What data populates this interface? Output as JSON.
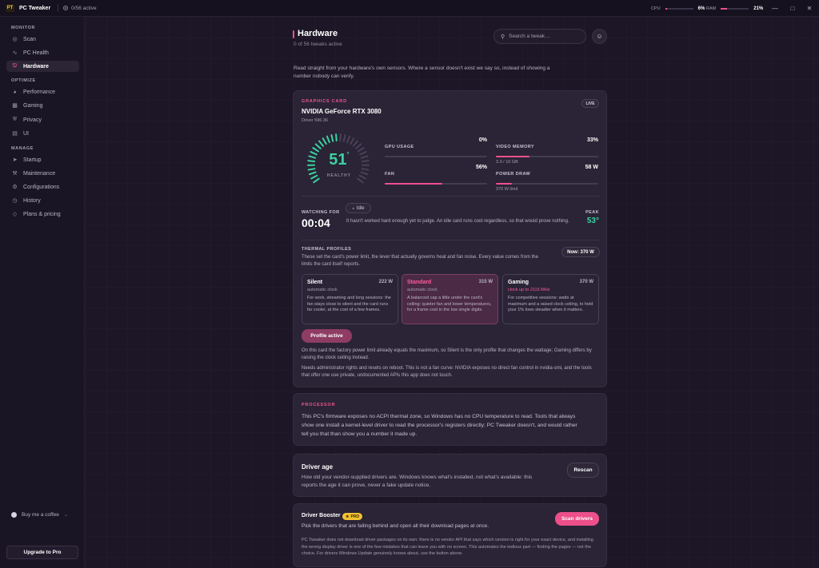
{
  "app": {
    "name": "PC Tweaker",
    "logo_text": "PT",
    "active_status": "0/56 active"
  },
  "meters": {
    "cpu_label": "CPU",
    "cpu_value": "6%",
    "cpu_fraction": 0.06,
    "ram_label": "RAM",
    "ram_value": "21%",
    "ram_fraction": 0.21
  },
  "sidebar": {
    "sections": {
      "monitor": "MONITOR",
      "optimize": "OPTIMIZE",
      "manage": "MANAGE"
    },
    "items": [
      {
        "label": "Scan",
        "icon": "scan-icon"
      },
      {
        "label": "PC Health",
        "icon": "pulse-icon"
      },
      {
        "label": "Hardware",
        "icon": "thermometer-icon",
        "active": true
      },
      {
        "label": "Performance",
        "icon": "gauge-icon"
      },
      {
        "label": "Gaming",
        "icon": "gamepad-icon"
      },
      {
        "label": "Privacy",
        "icon": "shield-icon"
      },
      {
        "label": "UI",
        "icon": "window-icon"
      },
      {
        "label": "Startup",
        "icon": "rocket-icon"
      },
      {
        "label": "Maintenance",
        "icon": "wrench-icon"
      },
      {
        "label": "Configurations",
        "icon": "sliders-icon"
      },
      {
        "label": "History",
        "icon": "clock-icon"
      },
      {
        "label": "Plans & pricing",
        "icon": "diamond-icon"
      }
    ],
    "coffee": "Buy me a coffee",
    "upgrade": "Upgrade to Pro"
  },
  "header": {
    "title": "Hardware",
    "subtitle": "0 of 56 tweaks active",
    "search_placeholder": "Search a tweak…"
  },
  "intro": "Read straight from your hardware's own sensors. Where a sensor doesn't exist we say so, instead of showing a number nobody can verify.",
  "gpu": {
    "tag": "GRAPHICS CARD",
    "name": "NVIDIA GeForce RTX 3080",
    "driver": "Driver 596.36",
    "live": "LIVE",
    "temp": "51",
    "temp_unit": "°",
    "temp_status": "HEALTHY",
    "gauge_fraction": 0.51,
    "stats": [
      {
        "label": "GPU USAGE",
        "value": "0%",
        "fraction": 0.0,
        "note": ""
      },
      {
        "label": "VIDEO MEMORY",
        "value": "33%",
        "fraction": 0.33,
        "note": "3.3 / 10 GB"
      },
      {
        "label": "FAN",
        "value": "56%",
        "fraction": 0.56,
        "note": ""
      },
      {
        "label": "POWER DRAW",
        "value": "58 W",
        "fraction": 0.16,
        "note": "370 W limit"
      }
    ],
    "watching_label": "WATCHING FOR",
    "watching_time": "00:04",
    "idle_pill": "Idle",
    "idle_text": "It hasn't worked hard enough yet to judge. An idle card runs cool regardless, so that would prove nothing.",
    "peak_label": "PEAK",
    "peak_value": "53°",
    "thermal_title": "THERMAL PROFILES",
    "thermal_desc": "These set the card's power limit, the lever that actually governs heat and fan noise. Every value comes from the limits the card itself reports.",
    "now_pill": "Now: 370 W",
    "profiles": [
      {
        "name": "Silent",
        "watts": "222 W",
        "mode": "automatic clock",
        "desc": "For work, streaming and long sessions: the fan stays close to silent and the card runs far cooler, at the cost of a few frames."
      },
      {
        "name": "Standard",
        "watts": "315 W",
        "mode": "automatic clock",
        "desc": "A balanced cap a little under the card's ceiling: quieter fan and lower temperatures, for a frame cost in the low single digits."
      },
      {
        "name": "Gaming",
        "watts": "370 W",
        "mode": "clock up to 2115 MHz",
        "desc": "For competitive sessions: watts at maximum and a raised clock ceiling, to hold your 1% lows steadier when it matters."
      }
    ],
    "profile_button": "Profile active",
    "note1": "On this card the factory power limit already equals the maximum, so Silent is the only profile that changes the wattage; Gaming differs by raising the clock ceiling instead.",
    "note2": "Needs administrator rights and resets on reboot. This is not a fan curve: NVIDIA exposes no direct fan control in nvidia-smi, and the tools that offer one use private, undocumented APIs this app does not touch."
  },
  "processor": {
    "tag": "PROCESSOR",
    "text": "This PC's firmware exposes no ACPI thermal zone, so Windows has no CPU temperature to read. Tools that always show one install a kernel-level driver to read the processor's registers directly; PC Tweaker doesn't, and would rather tell you that than show you a number it made up."
  },
  "driver_age": {
    "title": "Driver age",
    "text": "How old your vendor-supplied drivers are. Windows knows what's installed, not what's available: this reports the age it can prove, never a fake update notice.",
    "button": "Rescan"
  },
  "booster": {
    "title": "Driver Booster",
    "badge": "PRO",
    "subtitle": "Pick the drivers that are falling behind and open all their download pages at once.",
    "button": "Scan drivers",
    "text": "PC Tweaker does not download driver packages on its own: there is no vendor API that says which version is right for your exact device, and installing the wrong display driver is one of the few mistakes that can leave you with no screen. This automates the tedious part — finding the pages — not the choice. For drivers Windows Update genuinely knows about, use the button above."
  },
  "colors": {
    "accent": "#ec4f8a",
    "healthy": "#3ad29f",
    "background": "#1c1727",
    "card": "#2a2436"
  }
}
